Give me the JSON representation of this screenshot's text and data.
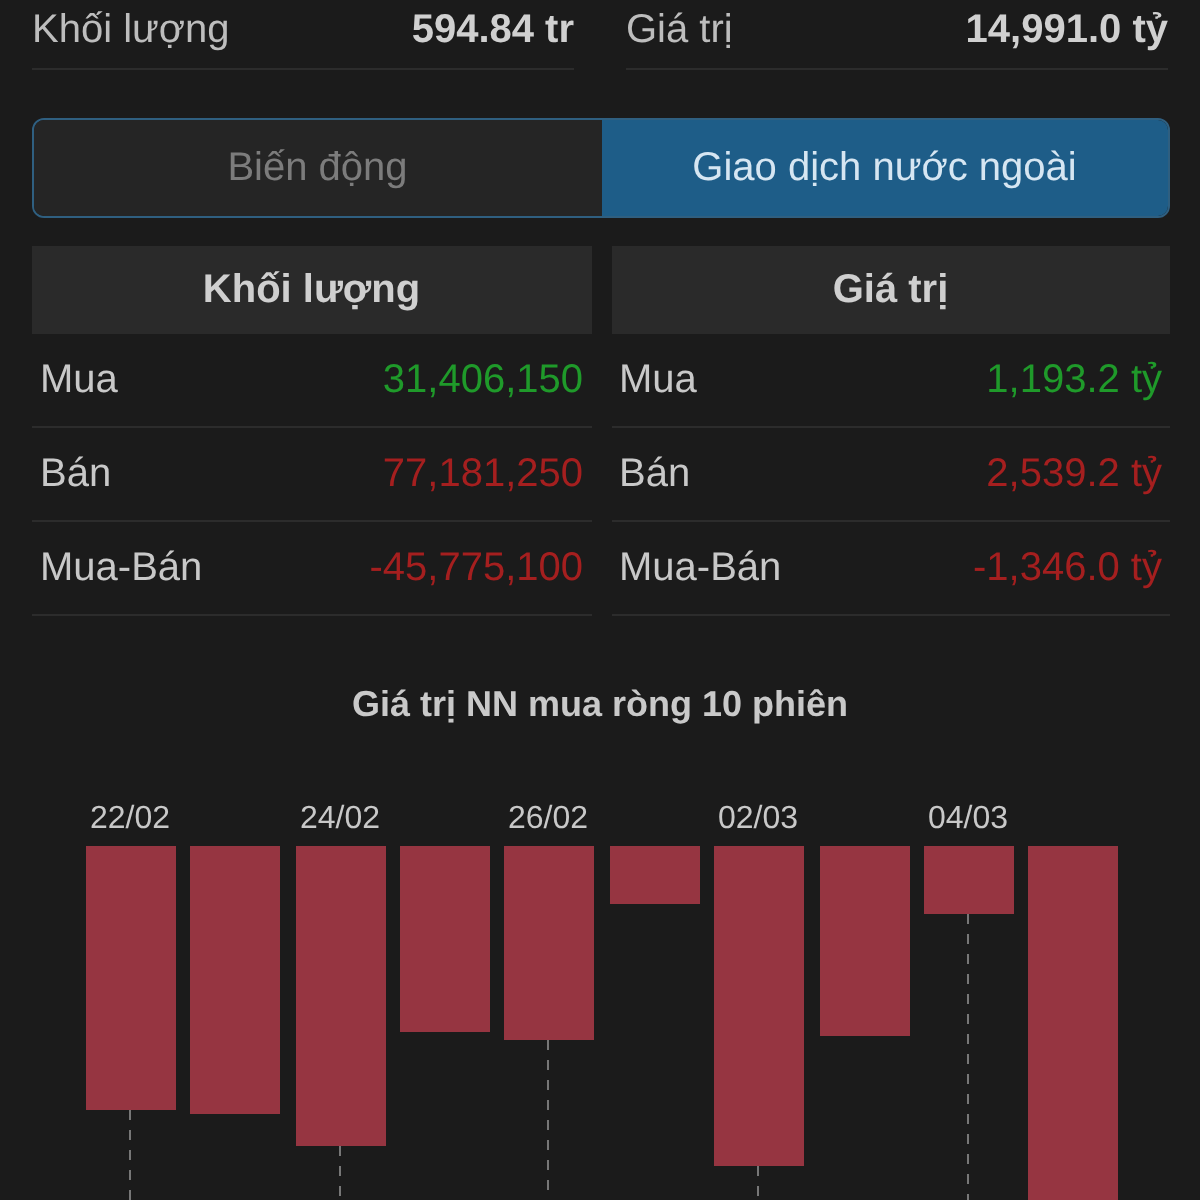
{
  "summary": [
    {
      "label": "Khối lượng",
      "value": "594.84 tr"
    },
    {
      "label": "Giá trị",
      "value": "14,991.0 tỷ"
    }
  ],
  "tabs": [
    {
      "label": "Biến động",
      "selected": false
    },
    {
      "label": "Giao dịch nước ngoài",
      "selected": true
    }
  ],
  "tables": [
    {
      "header": "Khối lượng",
      "rows": [
        {
          "label": "Mua",
          "value": "31,406,150",
          "color": "#1f9a2a"
        },
        {
          "label": "Bán",
          "value": "77,181,250",
          "color": "#a51f1f"
        },
        {
          "label": "Mua-Bán",
          "value": "-45,775,100",
          "color": "#a51f1f"
        }
      ]
    },
    {
      "header": "Giá trị",
      "rows": [
        {
          "label": "Mua",
          "value": "1,193.2 tỷ",
          "color": "#1f9a2a"
        },
        {
          "label": "Bán",
          "value": "2,539.2 tỷ",
          "color": "#a51f1f"
        },
        {
          "label": "Mua-Bán",
          "value": "-1,346.0 tỷ",
          "color": "#a51f1f"
        }
      ]
    }
  ],
  "chart": {
    "title": "Giá trị NN mua ròng 10 phiên",
    "date_labels": [
      "22/02",
      "24/02",
      "26/02",
      "02/03",
      "04/03"
    ]
  }
}
